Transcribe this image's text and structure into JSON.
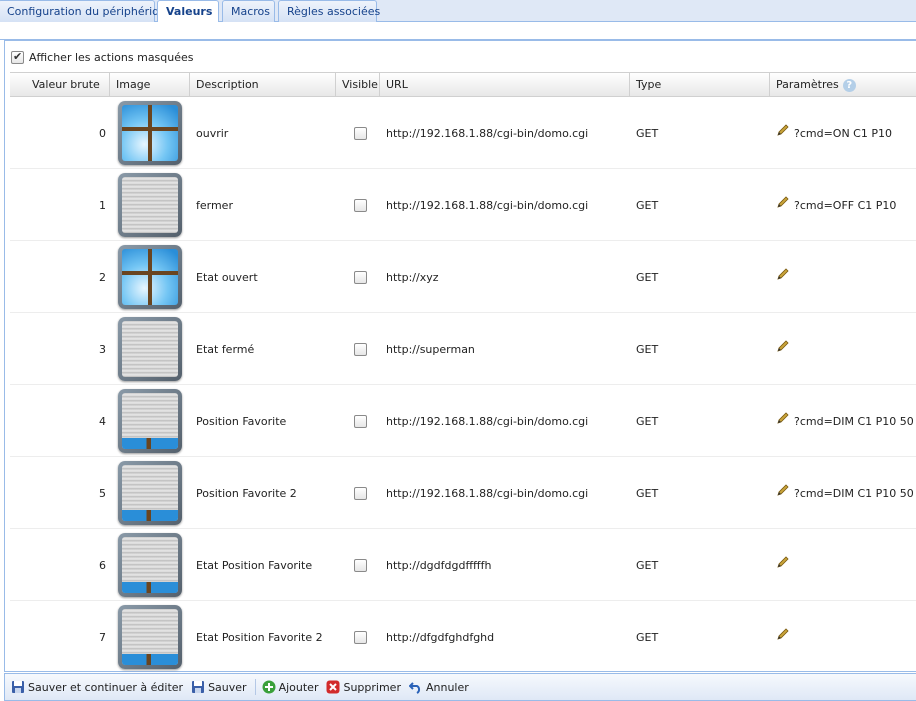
{
  "tabs": [
    {
      "label": "Configuration du périphérique"
    },
    {
      "label": "Valeurs"
    },
    {
      "label": "Macros"
    },
    {
      "label": "Règles associées"
    }
  ],
  "show_hidden": {
    "label": "Afficher les actions masquées",
    "checked": true
  },
  "columns": {
    "raw": "Valeur brute",
    "image": "Image",
    "description": "Description",
    "visible": "Visible",
    "url": "URL",
    "type": "Type",
    "params": "Paramètres"
  },
  "rows": [
    {
      "raw": "0",
      "image": "open",
      "description": "ouvrir",
      "url": "http://192.168.1.88/cgi-bin/domo.cgi",
      "type": "GET",
      "params": "?cmd=ON C1 P10"
    },
    {
      "raw": "1",
      "image": "closed",
      "description": "fermer",
      "url": "http://192.168.1.88/cgi-bin/domo.cgi",
      "type": "GET",
      "params": "?cmd=OFF C1 P10"
    },
    {
      "raw": "2",
      "image": "open",
      "description": "Etat ouvert",
      "url": "http://xyz",
      "type": "GET",
      "params": ""
    },
    {
      "raw": "3",
      "image": "closed",
      "description": "Etat fermé",
      "url": "http://superman",
      "type": "GET",
      "params": ""
    },
    {
      "raw": "4",
      "image": "fav",
      "description": "Position Favorite",
      "url": "http://192.168.1.88/cgi-bin/domo.cgi",
      "type": "GET",
      "params": "?cmd=DIM C1 P10 50"
    },
    {
      "raw": "5",
      "image": "fav",
      "description": "Position Favorite 2",
      "url": "http://192.168.1.88/cgi-bin/domo.cgi",
      "type": "GET",
      "params": "?cmd=DIM C1 P10 50"
    },
    {
      "raw": "6",
      "image": "fav",
      "description": "Etat Position Favorite",
      "url": "http://dgdfdgdfffffh",
      "type": "GET",
      "params": ""
    },
    {
      "raw": "7",
      "image": "fav",
      "description": "Etat Position Favorite 2",
      "url": "http://dfgdfghdfghd",
      "type": "GET",
      "params": ""
    }
  ],
  "toolbar": {
    "save_continue": "Sauver et continuer à éditer",
    "save": "Sauver",
    "add": "Ajouter",
    "delete": "Supprimer",
    "cancel": "Annuler"
  }
}
